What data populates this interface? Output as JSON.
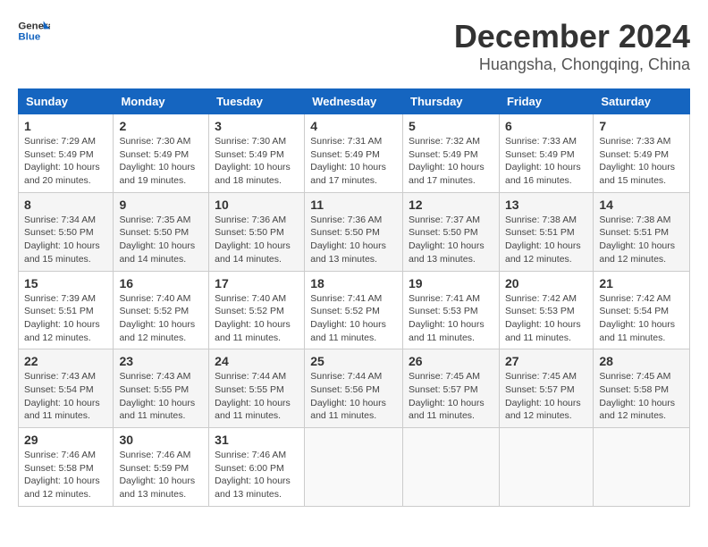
{
  "header": {
    "logo_line1": "General",
    "logo_line2": "Blue",
    "main_title": "December 2024",
    "subtitle": "Huangsha, Chongqing, China"
  },
  "calendar": {
    "days_of_week": [
      "Sunday",
      "Monday",
      "Tuesday",
      "Wednesday",
      "Thursday",
      "Friday",
      "Saturday"
    ],
    "weeks": [
      [
        {
          "day": "",
          "info": ""
        },
        {
          "day": "2",
          "info": "Sunrise: 7:30 AM\nSunset: 5:49 PM\nDaylight: 10 hours\nand 19 minutes."
        },
        {
          "day": "3",
          "info": "Sunrise: 7:30 AM\nSunset: 5:49 PM\nDaylight: 10 hours\nand 18 minutes."
        },
        {
          "day": "4",
          "info": "Sunrise: 7:31 AM\nSunset: 5:49 PM\nDaylight: 10 hours\nand 17 minutes."
        },
        {
          "day": "5",
          "info": "Sunrise: 7:32 AM\nSunset: 5:49 PM\nDaylight: 10 hours\nand 17 minutes."
        },
        {
          "day": "6",
          "info": "Sunrise: 7:33 AM\nSunset: 5:49 PM\nDaylight: 10 hours\nand 16 minutes."
        },
        {
          "day": "7",
          "info": "Sunrise: 7:33 AM\nSunset: 5:49 PM\nDaylight: 10 hours\nand 15 minutes."
        }
      ],
      [
        {
          "day": "1",
          "info": "Sunrise: 7:29 AM\nSunset: 5:49 PM\nDaylight: 10 hours\nand 20 minutes."
        },
        {
          "day": "9",
          "info": "Sunrise: 7:35 AM\nSunset: 5:50 PM\nDaylight: 10 hours\nand 14 minutes."
        },
        {
          "day": "10",
          "info": "Sunrise: 7:36 AM\nSunset: 5:50 PM\nDaylight: 10 hours\nand 14 minutes."
        },
        {
          "day": "11",
          "info": "Sunrise: 7:36 AM\nSunset: 5:50 PM\nDaylight: 10 hours\nand 13 minutes."
        },
        {
          "day": "12",
          "info": "Sunrise: 7:37 AM\nSunset: 5:50 PM\nDaylight: 10 hours\nand 13 minutes."
        },
        {
          "day": "13",
          "info": "Sunrise: 7:38 AM\nSunset: 5:51 PM\nDaylight: 10 hours\nand 12 minutes."
        },
        {
          "day": "14",
          "info": "Sunrise: 7:38 AM\nSunset: 5:51 PM\nDaylight: 10 hours\nand 12 minutes."
        }
      ],
      [
        {
          "day": "8",
          "info": "Sunrise: 7:34 AM\nSunset: 5:50 PM\nDaylight: 10 hours\nand 15 minutes."
        },
        {
          "day": "16",
          "info": "Sunrise: 7:40 AM\nSunset: 5:52 PM\nDaylight: 10 hours\nand 12 minutes."
        },
        {
          "day": "17",
          "info": "Sunrise: 7:40 AM\nSunset: 5:52 PM\nDaylight: 10 hours\nand 11 minutes."
        },
        {
          "day": "18",
          "info": "Sunrise: 7:41 AM\nSunset: 5:52 PM\nDaylight: 10 hours\nand 11 minutes."
        },
        {
          "day": "19",
          "info": "Sunrise: 7:41 AM\nSunset: 5:53 PM\nDaylight: 10 hours\nand 11 minutes."
        },
        {
          "day": "20",
          "info": "Sunrise: 7:42 AM\nSunset: 5:53 PM\nDaylight: 10 hours\nand 11 minutes."
        },
        {
          "day": "21",
          "info": "Sunrise: 7:42 AM\nSunset: 5:54 PM\nDaylight: 10 hours\nand 11 minutes."
        }
      ],
      [
        {
          "day": "15",
          "info": "Sunrise: 7:39 AM\nSunset: 5:51 PM\nDaylight: 10 hours\nand 12 minutes."
        },
        {
          "day": "23",
          "info": "Sunrise: 7:43 AM\nSunset: 5:55 PM\nDaylight: 10 hours\nand 11 minutes."
        },
        {
          "day": "24",
          "info": "Sunrise: 7:44 AM\nSunset: 5:55 PM\nDaylight: 10 hours\nand 11 minutes."
        },
        {
          "day": "25",
          "info": "Sunrise: 7:44 AM\nSunset: 5:56 PM\nDaylight: 10 hours\nand 11 minutes."
        },
        {
          "day": "26",
          "info": "Sunrise: 7:45 AM\nSunset: 5:57 PM\nDaylight: 10 hours\nand 11 minutes."
        },
        {
          "day": "27",
          "info": "Sunrise: 7:45 AM\nSunset: 5:57 PM\nDaylight: 10 hours\nand 12 minutes."
        },
        {
          "day": "28",
          "info": "Sunrise: 7:45 AM\nSunset: 5:58 PM\nDaylight: 10 hours\nand 12 minutes."
        }
      ],
      [
        {
          "day": "22",
          "info": "Sunrise: 7:43 AM\nSunset: 5:54 PM\nDaylight: 10 hours\nand 11 minutes."
        },
        {
          "day": "30",
          "info": "Sunrise: 7:46 AM\nSunset: 5:59 PM\nDaylight: 10 hours\nand 13 minutes."
        },
        {
          "day": "31",
          "info": "Sunrise: 7:46 AM\nSunset: 6:00 PM\nDaylight: 10 hours\nand 13 minutes."
        },
        {
          "day": "",
          "info": ""
        },
        {
          "day": "",
          "info": ""
        },
        {
          "day": "",
          "info": ""
        },
        {
          "day": ""
        }
      ],
      [
        {
          "day": "29",
          "info": "Sunrise: 7:46 AM\nSunset: 5:58 PM\nDaylight: 10 hours\nand 12 minutes."
        },
        {
          "day": "",
          "info": ""
        },
        {
          "day": "",
          "info": ""
        },
        {
          "day": "",
          "info": ""
        },
        {
          "day": "",
          "info": ""
        },
        {
          "day": "",
          "info": ""
        },
        {
          "day": "",
          "info": ""
        }
      ]
    ]
  }
}
